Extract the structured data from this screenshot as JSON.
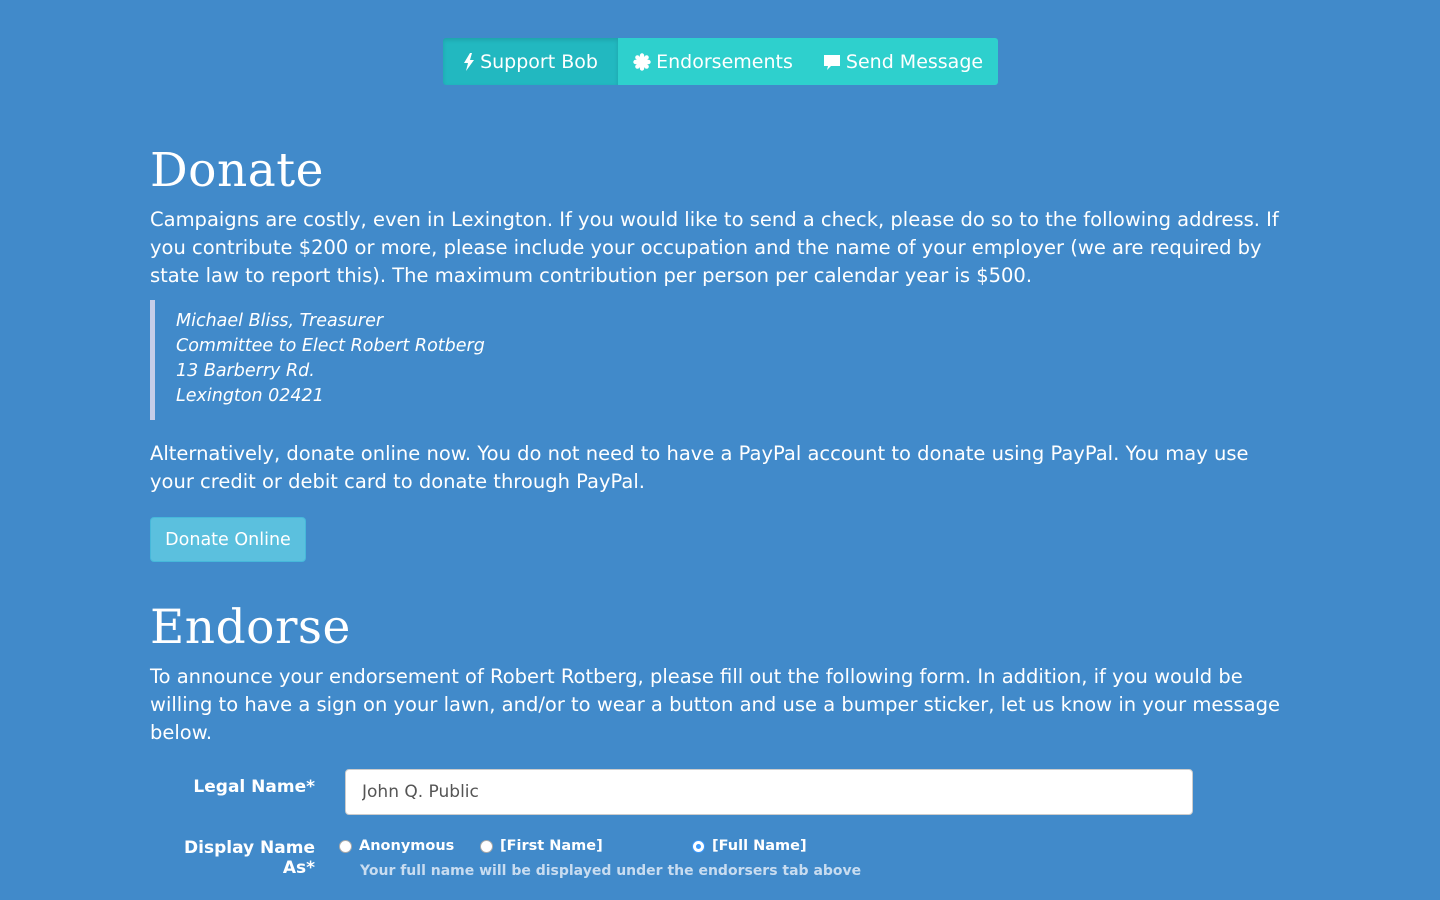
{
  "nav": {
    "tabs": [
      {
        "label": "Support Bob",
        "icon": "bolt-icon"
      },
      {
        "label": "Endorsements",
        "icon": "certificate-icon"
      },
      {
        "label": "Send Message",
        "icon": "comment-icon"
      }
    ]
  },
  "donate": {
    "heading": "Donate",
    "intro": "Campaigns are costly, even in Lexington. If you would like to send a check, please do so to the following address. If you contribute $200 or more, please include your occupation and the name of your employer (we are required by state law to report this). The maximum contribution per person per calendar year is $500.",
    "address": [
      "Michael Bliss, Treasurer",
      "Committee to Elect Robert Rotberg",
      "13 Barberry Rd.",
      "Lexington 02421"
    ],
    "online_text": "Alternatively, donate online now. You do not need to have a PayPal account to donate using PayPal. You may use your credit or debit card to donate through PayPal.",
    "button_label": "Donate Online"
  },
  "endorse": {
    "heading": "Endorse",
    "intro": "To announce your endorsement of Robert Rotberg, please fill out the following form. In addition, if you would be willing to have a sign on your lawn, and/or to wear a button and use a bumper sticker, let us know in your message below.",
    "legal_name_label": "Legal Name*",
    "legal_name_value": "John Q. Public",
    "display_name_label": "Display Name As*",
    "display_options": [
      {
        "label": "Anonymous",
        "checked": false
      },
      {
        "label": "[First Name]",
        "checked": false
      },
      {
        "label": "[Full Name]",
        "checked": true
      }
    ],
    "help_text": "Your full name will be displayed under the endorsers tab above"
  },
  "colors": {
    "background": "#418aca",
    "tab_active": "#22b8c0",
    "tab": "#2ed0cd",
    "button_info": "#5bc0de"
  }
}
